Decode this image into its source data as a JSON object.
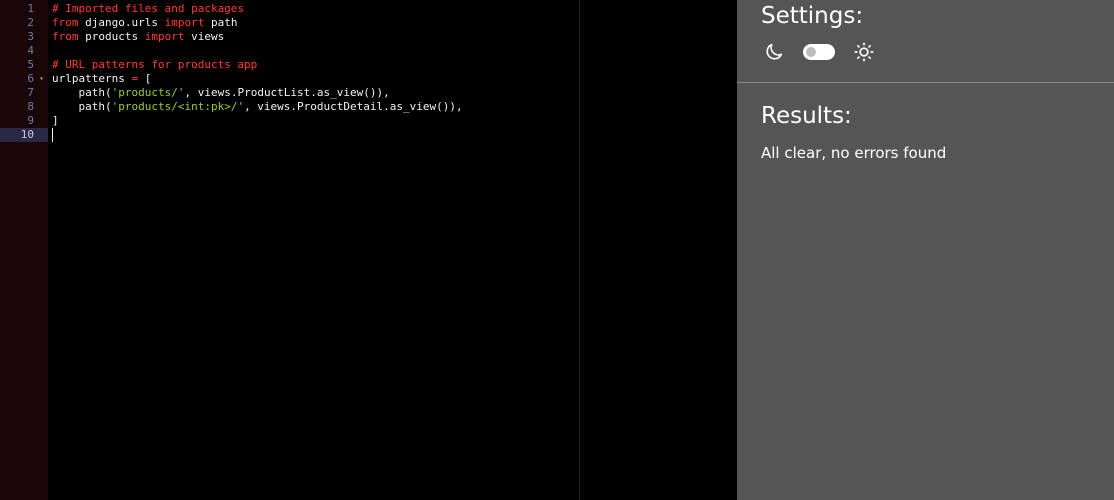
{
  "editor": {
    "line_numbers": [
      "1",
      "2",
      "3",
      "4",
      "5",
      "6",
      "7",
      "8",
      "9",
      "10"
    ],
    "active_line": "10",
    "lines": [
      [
        {
          "t": "comment",
          "v": "# Imported files and packages"
        }
      ],
      [
        {
          "t": "keyword",
          "v": "from"
        },
        {
          "t": "plain",
          "v": " django.urls "
        },
        {
          "t": "keyword",
          "v": "import"
        },
        {
          "t": "plain",
          "v": " path"
        }
      ],
      [
        {
          "t": "keyword",
          "v": "from"
        },
        {
          "t": "plain",
          "v": " products "
        },
        {
          "t": "keyword",
          "v": "import"
        },
        {
          "t": "plain",
          "v": " views"
        }
      ],
      [],
      [
        {
          "t": "comment",
          "v": "# URL patterns for products app"
        }
      ],
      [
        {
          "t": "plain",
          "v": "urlpatterns "
        },
        {
          "t": "op",
          "v": "="
        },
        {
          "t": "plain",
          "v": " ["
        }
      ],
      [
        {
          "t": "plain",
          "v": "    path("
        },
        {
          "t": "string",
          "v": "'products/'"
        },
        {
          "t": "plain",
          "v": ", views.ProductList.as_view()),"
        }
      ],
      [
        {
          "t": "plain",
          "v": "    path("
        },
        {
          "t": "string",
          "v": "'products/<int:pk>/'"
        },
        {
          "t": "plain",
          "v": ", views.ProductDetail.as_view()),"
        }
      ],
      [
        {
          "t": "plain",
          "v": "]"
        }
      ],
      []
    ]
  },
  "settings": {
    "title": "Settings:",
    "dark_icon": "moon-icon",
    "light_icon": "sun-icon",
    "toggle_state": "dark"
  },
  "results": {
    "title": "Results:",
    "message": "All clear, no errors found"
  },
  "colors": {
    "editor_bg": "#000000",
    "gutter_bg": "#1a0507",
    "keyword": "#ff3b30",
    "string": "#9ccc2a",
    "panel_bg": "#555555"
  }
}
